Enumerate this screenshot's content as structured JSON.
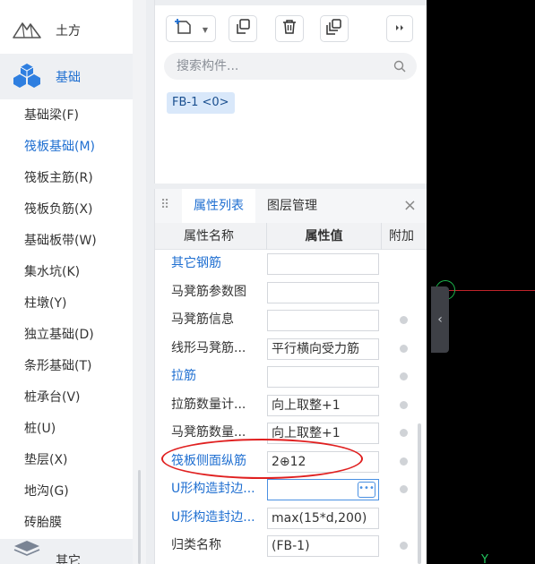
{
  "left_nav": {
    "categories": [
      {
        "label": "土方",
        "icon": "mountain-icon"
      },
      {
        "label": "基础",
        "icon": "cubes-icon",
        "active": true
      },
      {
        "label": "其它",
        "icon": "layers-icon"
      }
    ],
    "sub_items": [
      {
        "label": "基础梁(F)"
      },
      {
        "label": "筏板基础(M)",
        "active": true
      },
      {
        "label": "筏板主筋(R)"
      },
      {
        "label": "筏板负筋(X)"
      },
      {
        "label": "基础板带(W)"
      },
      {
        "label": "集水坑(K)"
      },
      {
        "label": "柱墩(Y)"
      },
      {
        "label": "独立基础(D)"
      },
      {
        "label": "条形基础(T)"
      },
      {
        "label": "桩承台(V)"
      },
      {
        "label": "桩(U)"
      },
      {
        "label": "垫层(X)"
      },
      {
        "label": "地沟(G)"
      },
      {
        "label": "砖胎膜"
      }
    ]
  },
  "component_panel": {
    "toolbar_icons": [
      "new-component-icon",
      "copy-icon",
      "delete-icon",
      "layer-copy-icon",
      "more-icon"
    ],
    "search_placeholder": "搜索构件...",
    "components": [
      "FB-1 <0>"
    ]
  },
  "property_panel": {
    "tabs": [
      {
        "label": "属性列表",
        "active": true
      },
      {
        "label": "图层管理"
      }
    ],
    "close_glyph": "×",
    "columns": {
      "name": "属性名称",
      "value": "属性值",
      "extra": "附加"
    },
    "rows": [
      {
        "name": "其它钢筋",
        "value": "",
        "blue": true,
        "dot": false
      },
      {
        "name": "马凳筋参数图",
        "value": "",
        "blue": false,
        "dot": false
      },
      {
        "name": "马凳筋信息",
        "value": "",
        "blue": false,
        "dot": true
      },
      {
        "name": "线形马凳筋...",
        "value": "平行横向受力筋",
        "blue": false,
        "dot": true
      },
      {
        "name": "拉筋",
        "value": "",
        "blue": true,
        "dot": true
      },
      {
        "name": "拉筋数量计...",
        "value": "向上取整+1",
        "blue": false,
        "dot": true
      },
      {
        "name": "马凳筋数量...",
        "value": "向上取整+1",
        "blue": false,
        "dot": true
      },
      {
        "name": "筏板侧面纵筋",
        "value": "2⊕12",
        "blue": true,
        "dot": true
      },
      {
        "name": "U形构造封边...",
        "value": "",
        "blue": true,
        "dot": true,
        "focused": true
      },
      {
        "name": "U形构造封边...",
        "value": "max(15*d,200)",
        "blue": true,
        "dot": false
      },
      {
        "name": "归类名称",
        "value": "(FB-1)",
        "blue": false,
        "dot": true
      }
    ]
  },
  "canvas": {
    "axis_label": "Y",
    "colors": {
      "background": "#000000",
      "axis_line": "#c0242a",
      "marker": "#1bb54c"
    }
  },
  "annotation": {
    "color": "#e02020",
    "highlighted_row": "筏板侧面纵筋"
  },
  "colors": {
    "accent": "#1f6fd1",
    "nav_active_bg": "#eef0f3",
    "chip_bg": "#d9e8fa"
  }
}
